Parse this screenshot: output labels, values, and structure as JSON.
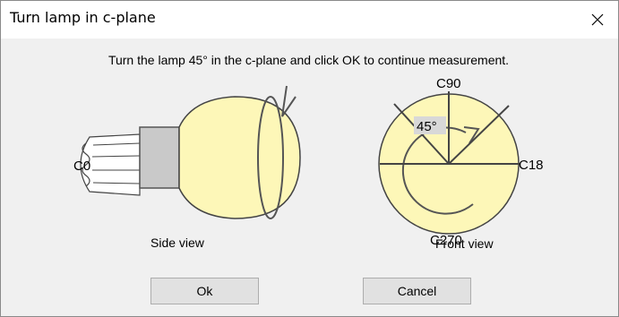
{
  "window": {
    "title": "Turn lamp in c-plane",
    "close_glyph": "✕"
  },
  "instruction": "Turn the lamp 45° in the c-plane and click OK to continue measurement.",
  "side_view": {
    "caption": "Side view",
    "plane_label": "C0"
  },
  "front_view": {
    "caption": "Front view",
    "top_label": "C90",
    "right_label": "C18",
    "bottom_label": "C270",
    "angle_label": "45°"
  },
  "buttons": {
    "ok_label": "Ok",
    "cancel_label": "Cancel"
  },
  "colors": {
    "bulb_fill": "#fdf7b8",
    "socket_fill": "#c9c9c9"
  }
}
